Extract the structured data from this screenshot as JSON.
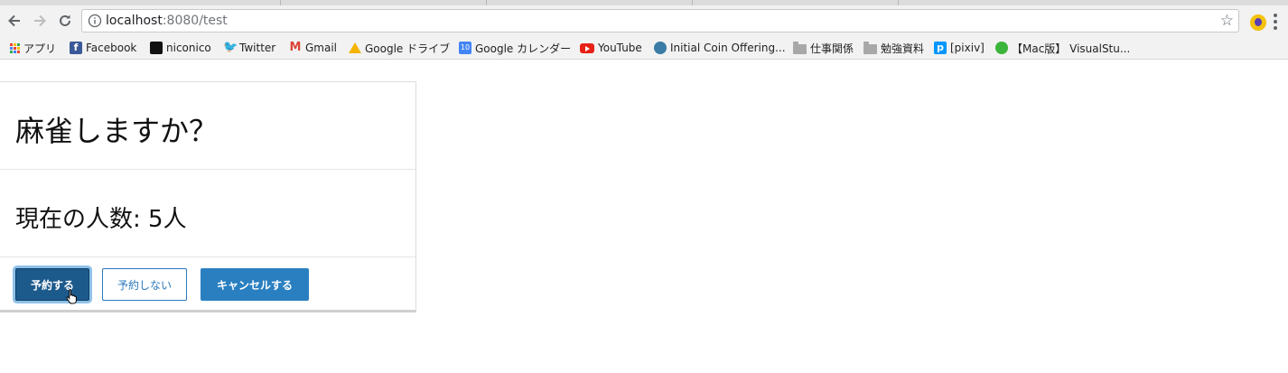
{
  "browser": {
    "url_host": "localhost",
    "url_rest": ":8080/test",
    "bookmarks": [
      {
        "label": "アプリ",
        "icon": "apps-grid-icon"
      },
      {
        "label": "Facebook",
        "icon": "facebook-icon"
      },
      {
        "label": "niconico",
        "icon": "niconico-icon"
      },
      {
        "label": "Twitter",
        "icon": "twitter-icon"
      },
      {
        "label": "Gmail",
        "icon": "gmail-icon"
      },
      {
        "label": "Google ドライブ",
        "icon": "google-drive-icon"
      },
      {
        "label": "Google カレンダー",
        "icon": "google-calendar-icon"
      },
      {
        "label": "YouTube",
        "icon": "youtube-icon"
      },
      {
        "label": "Initial Coin Offering...",
        "icon": "ico-site-icon"
      },
      {
        "label": "仕事関係",
        "icon": "folder-icon"
      },
      {
        "label": "勉強資料",
        "icon": "folder-icon"
      },
      {
        "label": "[pixiv]",
        "icon": "pixiv-icon"
      },
      {
        "label": "【Mac版】 VisualStu...",
        "icon": "visualstudio-icon"
      }
    ],
    "calendar_icon_day": "10"
  },
  "card": {
    "title": "麻雀しますか？",
    "count_text": "現在の人数: 5人",
    "buttons": {
      "reserve": "予約する",
      "no_reserve": "予約しない",
      "cancel": "キャンセルする"
    }
  },
  "colors": {
    "primary": "#2a7fc1",
    "primary_active": "#1d5a8c"
  }
}
